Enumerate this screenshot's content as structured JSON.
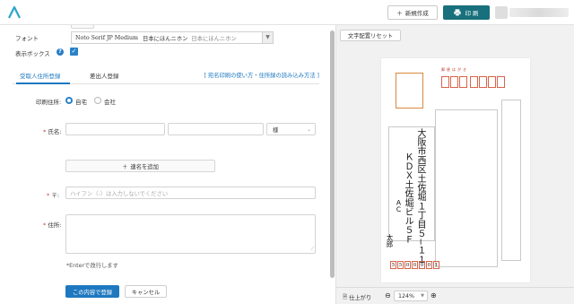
{
  "header": {
    "new_button": "新規作成",
    "print_button": "印 刷"
  },
  "form": {
    "font_label": "フォント",
    "font_value": "Noto Serif JP Medium",
    "font_sample": "日本にほんニホン",
    "font_preview": "日本にほんニホン",
    "display_box_label": "表示ボックス",
    "tabs": [
      "受取人住所登録",
      "差出人登録"
    ],
    "help_link": "[ 宛名印刷の使い方・住所録の読み込み方法 ]",
    "print_address_label": "印刷住所:",
    "radio_home": "自宅",
    "radio_company": "会社",
    "name_label": "氏名:",
    "honorific": "様",
    "add_name_button": "連名を追加",
    "zip_label": "〒:",
    "zip_placeholder": "ハイフン（-）は入力しないでください",
    "address_label": "住所:",
    "enter_hint": "*Enterで改行します",
    "register_button": "この内容で登録",
    "cancel_button": "キャンセル",
    "required_mark": "*"
  },
  "preview": {
    "reset_button": "文字配置リセット",
    "postal_label": "郵便はがき",
    "address_line1": "大阪市西区土佐堀１丁目５−１１",
    "address_line2": "ＫＤＸ土佐堀ビル５Ｆ",
    "company": "ＡＣ",
    "person": "太郎",
    "sender_zip_digits": [
      "5",
      "5",
      "0",
      "0",
      "0",
      "0",
      "1"
    ],
    "finish_label": "仕上がり",
    "zoom_value": "124%"
  },
  "colors": {
    "accent": "#1d78c0",
    "print_button": "#17707b",
    "postal_red": "#d8634a"
  }
}
